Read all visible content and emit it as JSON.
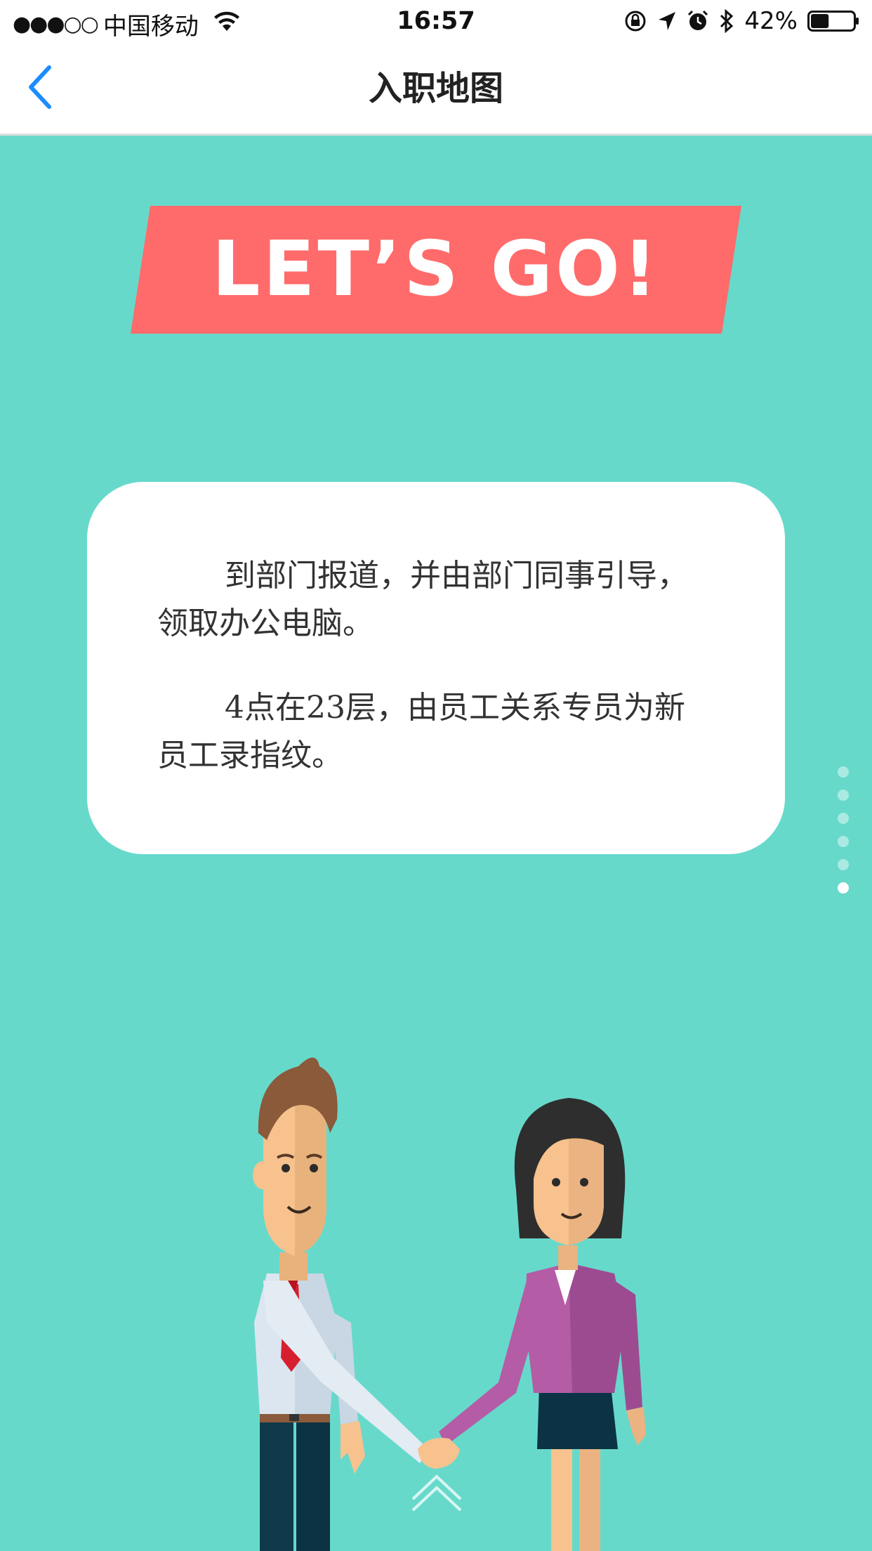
{
  "status_bar": {
    "signal": "●●●○○",
    "carrier": "中国移动",
    "time": "16:57",
    "battery_percent": "42%",
    "battery_level": 0.42,
    "icons": [
      "wifi-icon",
      "orientation-lock-icon",
      "location-icon",
      "alarm-icon",
      "bluetooth-icon",
      "battery-icon"
    ]
  },
  "nav": {
    "title": "入职地图",
    "back_icon": "chevron-left-icon"
  },
  "banner": {
    "text": "LET’S GO!",
    "color": "#ff6b6b"
  },
  "card": {
    "paragraphs": [
      "到部门报道，并由部门同事引导，领取办公电脑。",
      "4点在23层，由员工关系专员为新员工录指纹。"
    ]
  },
  "pager": {
    "total": 6,
    "active_index": 5
  },
  "colors": {
    "background": "#67d9cb",
    "accent": "#1a8cff"
  }
}
